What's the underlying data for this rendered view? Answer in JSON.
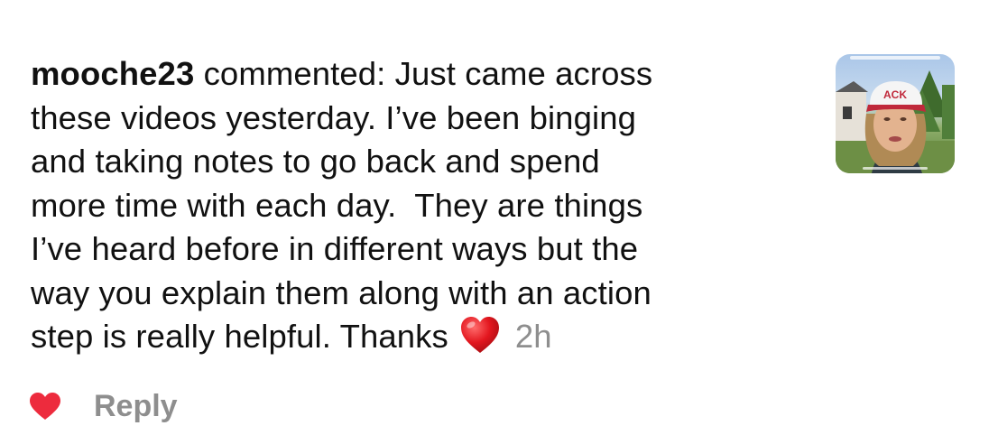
{
  "comment": {
    "username": "mooche23",
    "lines": [
      " commented: Just came across",
      "these videos yesterday. I’ve been binging",
      "and taking notes to go back and spend",
      "more time with each day.  They are things",
      "I’ve heard before in different ways but the",
      "way you explain them along with an action",
      "step is really helpful. Thanks"
    ],
    "emoji": "red-heart-emoji",
    "time": "2h"
  },
  "thumbnail": {
    "cap_text": "ACK",
    "accent_color": "#c0293b"
  },
  "actions": {
    "like_icon": "heart-icon",
    "like_color": "#ed2b3d",
    "reply_label": "Reply"
  }
}
